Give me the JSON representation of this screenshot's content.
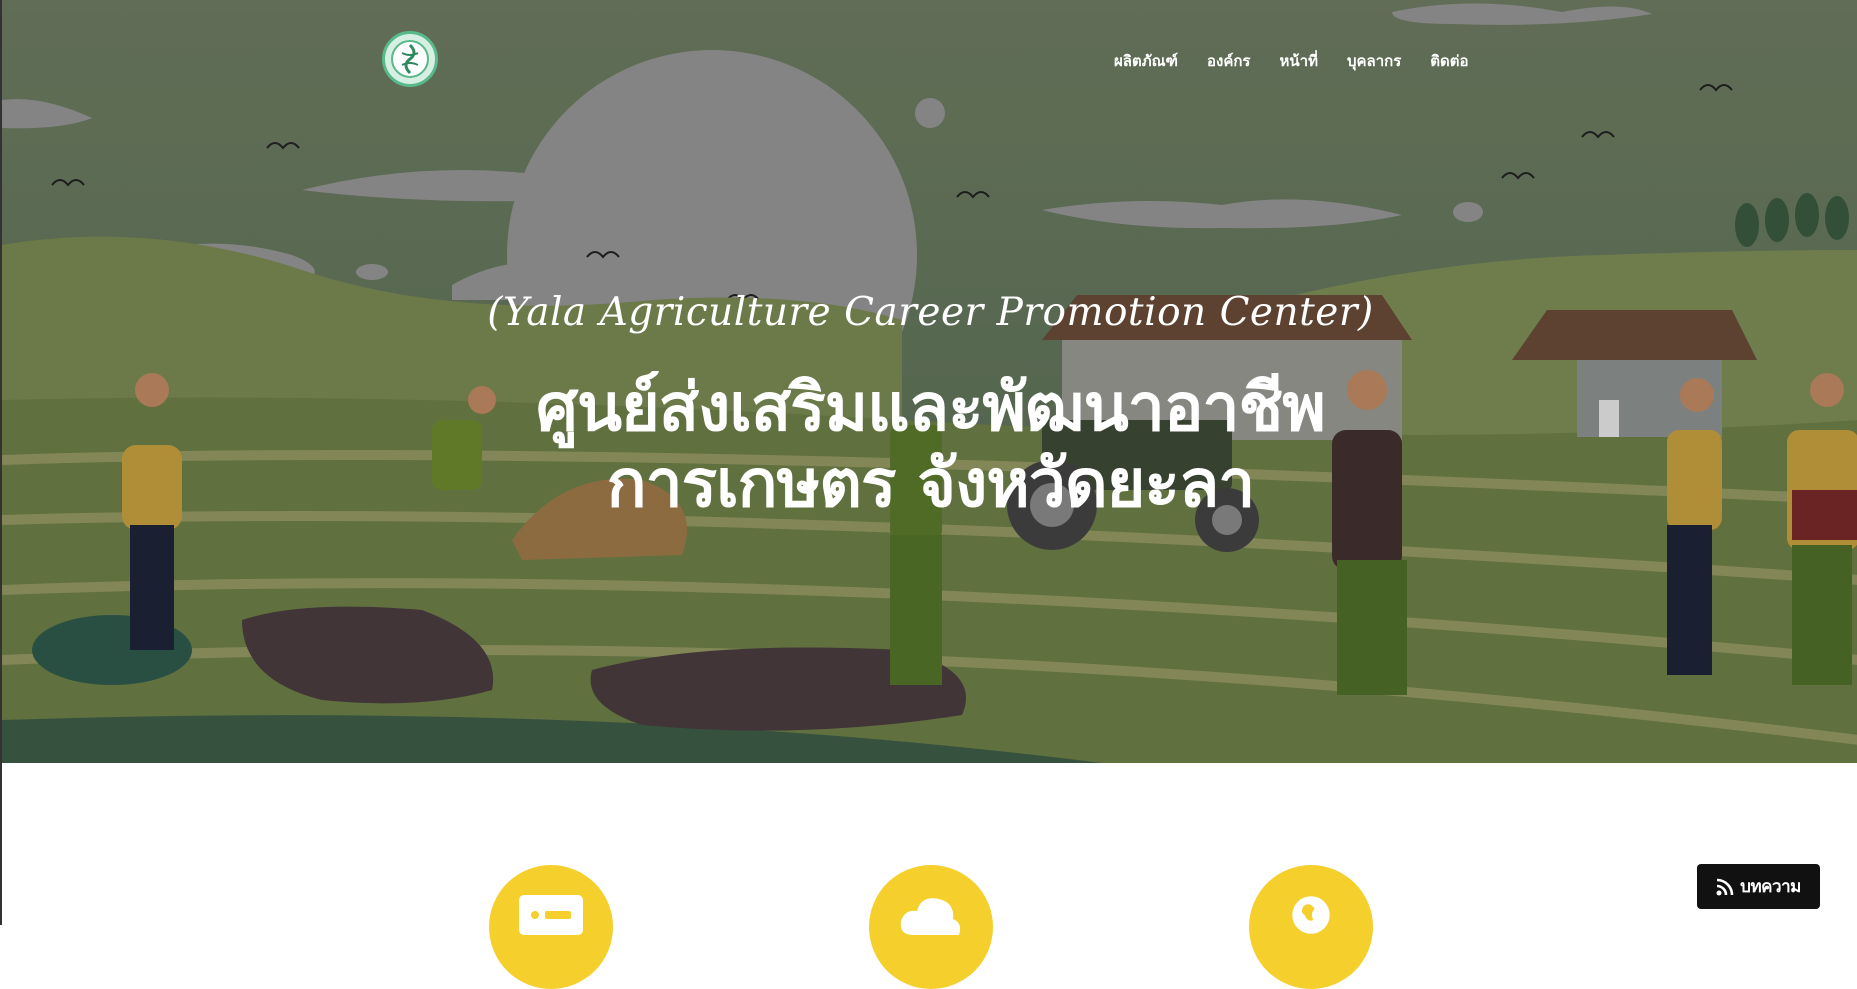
{
  "nav": {
    "logo_icon": "agriculture-emblem-icon",
    "items": [
      {
        "label": "ผลิตภัณฑ์"
      },
      {
        "label": "องค์กร"
      },
      {
        "label": "หน้าที่"
      },
      {
        "label": "บุคลากร"
      },
      {
        "label": "ติดต่อ"
      }
    ]
  },
  "hero": {
    "subtitle": "(Yala Agriculture Career Promotion Center)",
    "title_line1": "ศูนย์ส่งเสริมและพัฒนาอาชีพ",
    "title_line2": "การเกษตร จังหวัดยะลา"
  },
  "features": {
    "icons": [
      "id-card-icon",
      "cloud-icon",
      "globe-icon"
    ]
  },
  "article_button": {
    "label": "บทความ",
    "icon": "rss-icon"
  },
  "colors": {
    "accent": "#f5cf2c",
    "button_bg": "#111111",
    "logo_green": "#58b98a"
  }
}
